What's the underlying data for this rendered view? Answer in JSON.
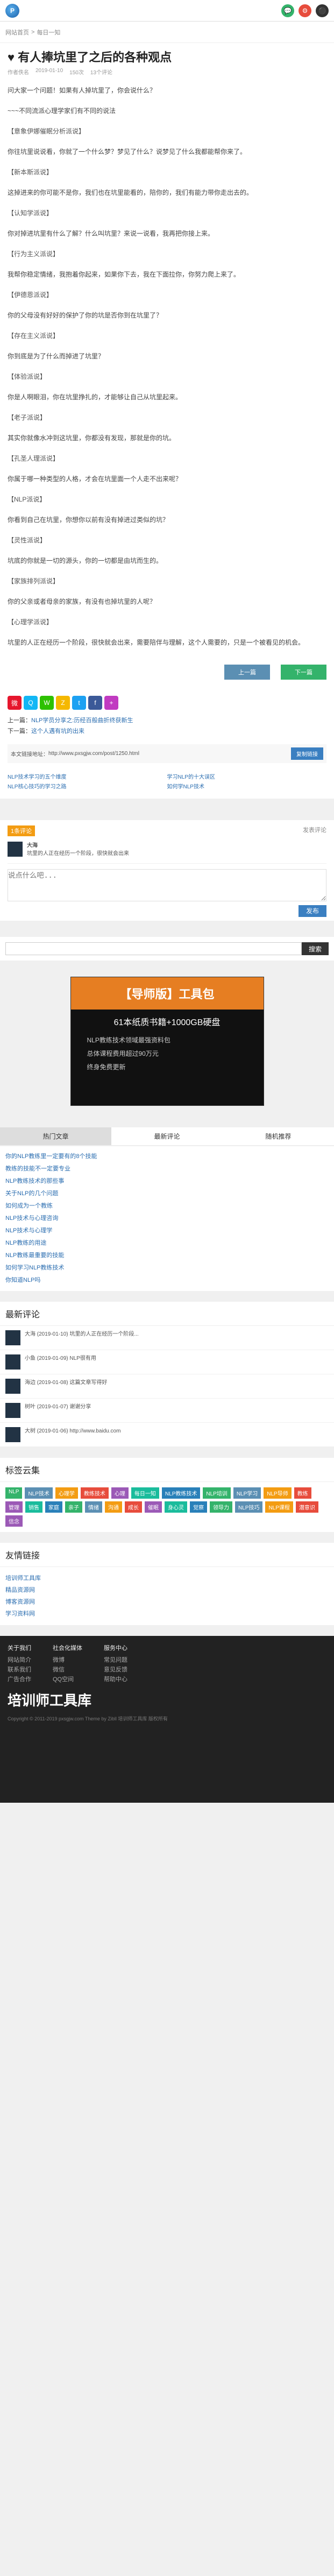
{
  "header": {
    "logo": "P",
    "icons": [
      "💬",
      "⚙",
      "⚫"
    ]
  },
  "breadcrumb": {
    "home": "网站首页",
    "sep": ">",
    "current": "每日一知"
  },
  "article": {
    "title": "♥ 有人捧坑里了之后的各种观点",
    "meta": [
      "作者佚名",
      "2019-01-10",
      "150次",
      "13个评论"
    ],
    "paragraphs": [
      "问大家一个问题！如果有人掉坑里了，你会说什么？",
      "~~~不同流派心理学家们有不同的说法",
      "【意象伊娜催眠分析派说】",
      "你往坑里说说看，你就了一个什么梦？梦见了什么？说梦见了什么我都能帮你来了。",
      "【新本斯派说】",
      "这掉进来的你可能不是你，我们也在坑里能看的，陪你的，我们有能力带你走出去的。",
      "【认知学派说】",
      "你对掉进坑里有什么了解？什么叫坑里？来说一说看，我再把你接上来。",
      "【行为主义派说】",
      "我帮你稳定情绪，我抱着你起来，如果你下去，我在下面拉你，你努力爬上来了。",
      "【伊德恩派说】",
      "你的父母没有好好的保护了你的坑是否你到在坑里了？",
      "【存在主义派说】",
      "你到底是为了什么而掉进了坑里？",
      "【体验派说】",
      "你是人啊眼泪，你在坑里挣扎的，才能够让自己从坑里起来。",
      "【老子派说】",
      "其实你就像水冲到这坑里，你都没有发现，那就是你的坑。",
      "【孔圣人理派说】",
      "你属于哪一种类型的人格，才会在坑里面一个人走不出来呢？",
      "【NLP派说】",
      "你看到自己在坑里，你想你以前有没有掉进过类似的坑？",
      "【灵性派说】",
      "坑底的你就是一切的源头，你的一切都是由坑而生的。",
      "【家族排列派说】",
      "你的父亲或者母亲的家族，有没有也掉坑里的人呢？",
      "【心理学派说】",
      "坑里的人正在经历一个阶段，很快就会出来，需要陪伴与理解，这个人需要的，只是一个被看见的机会。"
    ],
    "btn_share": "上一篇",
    "btn_next": "下一篇"
  },
  "share": {
    "icons": [
      "weibo-icon",
      "qq-icon",
      "wechat-icon",
      "qzone-icon",
      "twitter-icon",
      "facebook-icon",
      "plus-icon"
    ]
  },
  "nav": {
    "prev_label": "上一篇：",
    "prev": "NLP学员分享之:历经百般曲折终获新生",
    "next_label": "下一篇：",
    "next": "这个人遇有坑的出来"
  },
  "copy": {
    "label": "本文链接地址：",
    "url": "http://www.pxsgjw.com/post/1250.html",
    "button": "复制链接"
  },
  "related": {
    "items": [
      "NLP技术学习的五个维度",
      "学习NLP的十大误区",
      "NLP核心技巧的学习之路",
      "如何学NLP技术"
    ]
  },
  "comments": {
    "title": "1条评论",
    "count_label": "1",
    "reply_label": "发表评论",
    "comment_text": "坑里的人正在经历一个阶段，很快就会出来",
    "user": "大海",
    "placeholder": "说点什么吧...",
    "submit": "发布"
  },
  "search": {
    "placeholder": "",
    "button": "搜索"
  },
  "ad": {
    "title": "【导师版】工具包",
    "line1": "61本纸质书籍+1000GB硬盘",
    "line2": "NLP教练技术领域最强资料包",
    "line3": "总体课程费用超过90万元",
    "line4": "终身免费更新"
  },
  "tabs": [
    "热门文章",
    "最新评论",
    "随机推荐"
  ],
  "hot": [
    "你的NLP教练里一定要有的8个技能",
    "教练的技能不一定要专业",
    "NLP教练技术的那些事",
    "关于NLP的几个问题",
    "如何成为一个教练",
    "NLP技术与心理咨询",
    "NLP技术与心理学",
    "NLP教练的用途",
    "NLP教练最重要的技能",
    "如何学习NLP教练技术",
    "你知道NLP吗"
  ],
  "recent_title": "最新评论",
  "recent": [
    "大海 (2019-01-10) 坑里的人正在经历一个阶段...",
    "小鱼 (2019-01-09) NLP很有用",
    "海边 (2019-01-08) 这篇文章写得好",
    "树叶 (2019-01-07) 谢谢分享",
    "大树 (2019-01-06) http://www.baidu.com"
  ],
  "tags_title": "标签云集",
  "tags": [
    "NLP",
    "NLP技术",
    "心理学",
    "教练技术",
    "心理",
    "每日一知",
    "NLP教练技术",
    "NLP培训",
    "NLP学习",
    "NLP导师",
    "教练",
    "管理",
    "销售",
    "家庭",
    "亲子",
    "情绪",
    "沟通",
    "成长",
    "催眠",
    "身心灵",
    "觉察",
    "领导力",
    "NLP技巧",
    "NLP课程",
    "潜意识",
    "信念"
  ],
  "tag_colors": [
    "#34b36b",
    "#5b8fb3",
    "#f39c12",
    "#e74c3c",
    "#9b59b6",
    "#1abc9c",
    "#2980b9"
  ],
  "links_title": "友情链接",
  "links": [
    "培训师工具库",
    "精品资源网",
    "博客资源网",
    "学习资料网"
  ],
  "footer": {
    "col1": [
      "关于我们",
      "网站简介",
      "联系我们",
      "广告合作"
    ],
    "col2": [
      "社会化媒体",
      "微博",
      "微信",
      "QQ空间"
    ],
    "col3": [
      "服务中心",
      "常见问题",
      "意见反馈",
      "帮助中心"
    ],
    "logo": "培训师工具库",
    "copyright": "Copyright © 2011-2019 pxsgjw.com Theme by Zibll 培训师工具库 版权所有"
  }
}
